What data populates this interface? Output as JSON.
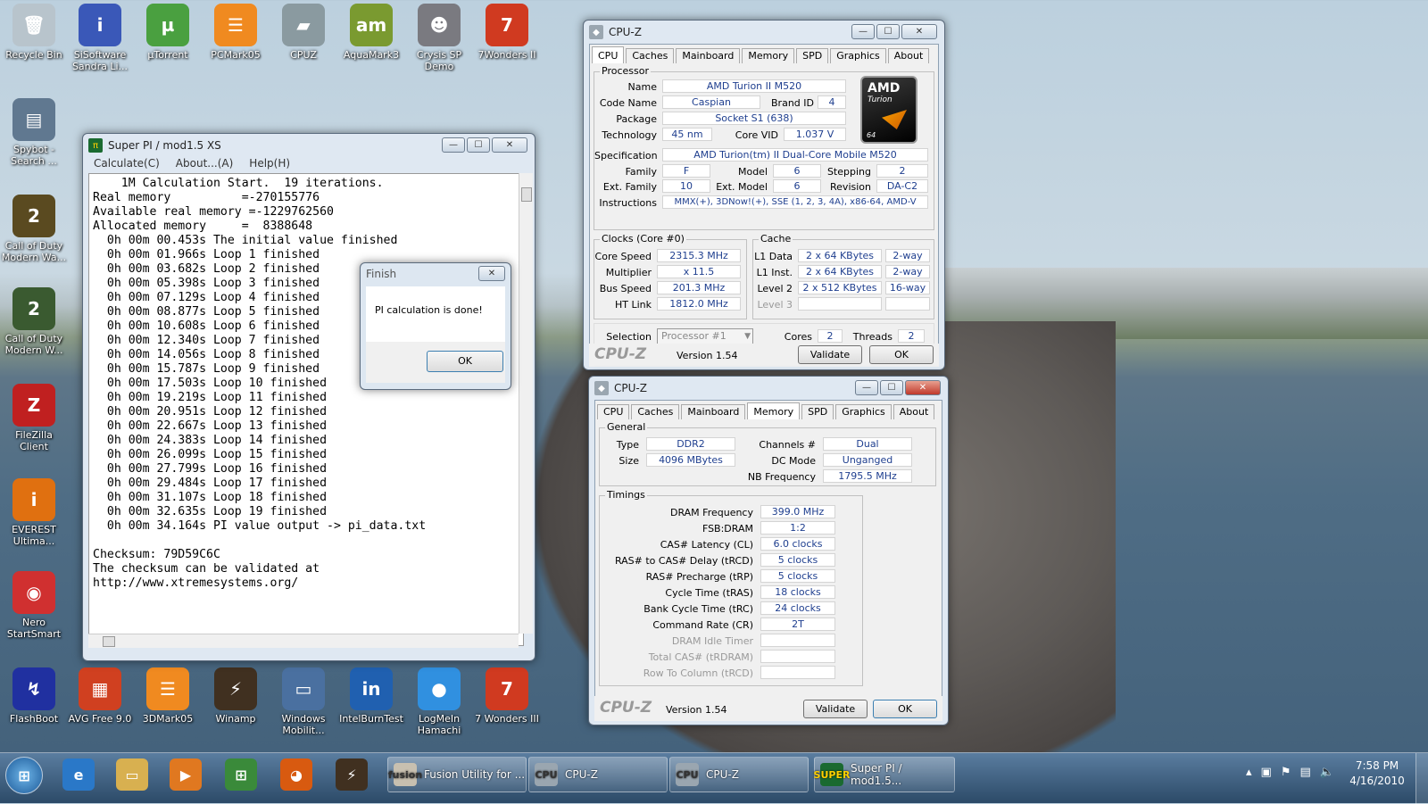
{
  "desktop": {
    "icons": [
      {
        "label": "Recycle Bin",
        "glyph": "🗑",
        "color": "#b8c4cc"
      },
      {
        "label": "SiSoftware Sandra Li...",
        "glyph": "i",
        "color": "#3a58b8"
      },
      {
        "label": "µTorrent",
        "glyph": "µ",
        "color": "#4aa040"
      },
      {
        "label": "PCMark05",
        "glyph": "☰",
        "color": "#f08a20"
      },
      {
        "label": "CPUZ",
        "glyph": "▰",
        "color": "#8a9aa0"
      },
      {
        "label": "AquaMark3",
        "glyph": "am",
        "color": "#7a9a30"
      },
      {
        "label": "Crysis SP Demo",
        "glyph": "☻",
        "color": "#7a7a80"
      },
      {
        "label": "7Wonders II",
        "glyph": "7",
        "color": "#d03a20"
      },
      {
        "label": "Spybot - Search ...",
        "glyph": "▤",
        "color": "#607890"
      },
      {
        "label": "Call of Duty Modern Wa...",
        "glyph": "2",
        "color": "#5a4a20"
      },
      {
        "label": "Call of Duty Modern W...",
        "glyph": "2",
        "color": "#3a5a30"
      },
      {
        "label": "FileZilla Client",
        "glyph": "Z",
        "color": "#c02020"
      },
      {
        "label": "EVEREST Ultima...",
        "glyph": "i",
        "color": "#e07010"
      },
      {
        "label": "Nero StartSmart",
        "glyph": "◉",
        "color": "#d03030"
      },
      {
        "label": "FlashBoot",
        "glyph": "↯",
        "color": "#2030a0"
      },
      {
        "label": "AVG Free 9.0",
        "glyph": "▦",
        "color": "#d04020"
      },
      {
        "label": "3DMark05",
        "glyph": "☰",
        "color": "#f08a20"
      },
      {
        "label": "Winamp",
        "glyph": "⚡",
        "color": "#403020"
      },
      {
        "label": "Windows Mobilit...",
        "glyph": "▭",
        "color": "#4a70a0"
      },
      {
        "label": "IntelBurnTest",
        "glyph": "in",
        "color": "#2060b0"
      },
      {
        "label": "LogMeIn Hamachi",
        "glyph": "●",
        "color": "#3090e0"
      },
      {
        "label": "7 Wonders III",
        "glyph": "7",
        "color": "#d03a20"
      }
    ]
  },
  "superpi": {
    "title": "Super PI / mod1.5 XS",
    "menu": [
      "Calculate(C)",
      "About...(A)",
      "Help(H)"
    ],
    "lines": [
      "    1M Calculation Start.  19 iterations.",
      "Real memory          =-270155776",
      "Available real memory =-1229762560",
      "Allocated memory     =  8388648",
      "  0h 00m 00.453s The initial value finished",
      "  0h 00m 01.966s Loop 1 finished",
      "  0h 00m 03.682s Loop 2 finished",
      "  0h 00m 05.398s Loop 3 finished",
      "  0h 00m 07.129s Loop 4 finished",
      "  0h 00m 08.877s Loop 5 finished",
      "  0h 00m 10.608s Loop 6 finished",
      "  0h 00m 12.340s Loop 7 finished",
      "  0h 00m 14.056s Loop 8 finished",
      "  0h 00m 15.787s Loop 9 finished",
      "  0h 00m 17.503s Loop 10 finished",
      "  0h 00m 19.219s Loop 11 finished",
      "  0h 00m 20.951s Loop 12 finished",
      "  0h 00m 22.667s Loop 13 finished",
      "  0h 00m 24.383s Loop 14 finished",
      "  0h 00m 26.099s Loop 15 finished",
      "  0h 00m 27.799s Loop 16 finished",
      "  0h 00m 29.484s Loop 17 finished",
      "  0h 00m 31.107s Loop 18 finished",
      "  0h 00m 32.635s Loop 19 finished",
      "  0h 00m 34.164s PI value output -> pi_data.txt",
      "",
      "Checksum: 79D59C6C",
      "The checksum can be validated at",
      "http://www.xtremesystems.org/"
    ]
  },
  "finish": {
    "title": "Finish",
    "message": "PI calculation is done!",
    "ok": "OK"
  },
  "cpuz1": {
    "title": "CPU-Z",
    "tabs": [
      "CPU",
      "Caches",
      "Mainboard",
      "Memory",
      "SPD",
      "Graphics",
      "About"
    ],
    "selected": "CPU",
    "processor_label": "Processor",
    "fields": {
      "name": {
        "label": "Name",
        "value": "AMD Turion II M520"
      },
      "codename": {
        "label": "Code Name",
        "value": "Caspian"
      },
      "brandid": {
        "label": "Brand ID",
        "value": "4"
      },
      "package": {
        "label": "Package",
        "value": "Socket S1 (638)"
      },
      "technology": {
        "label": "Technology",
        "value": "45 nm"
      },
      "corevid": {
        "label": "Core VID",
        "value": "1.037 V"
      },
      "spec": {
        "label": "Specification",
        "value": "AMD Turion(tm) II Dual-Core Mobile M520"
      },
      "family": {
        "label": "Family",
        "value": "F"
      },
      "model": {
        "label": "Model",
        "value": "6"
      },
      "stepping": {
        "label": "Stepping",
        "value": "2"
      },
      "extfamily": {
        "label": "Ext. Family",
        "value": "10"
      },
      "extmodel": {
        "label": "Ext. Model",
        "value": "6"
      },
      "revision": {
        "label": "Revision",
        "value": "DA-C2"
      },
      "instructions": {
        "label": "Instructions",
        "value": "MMX(+), 3DNow!(+), SSE (1, 2, 3, 4A), x86-64, AMD-V"
      }
    },
    "logo": {
      "brand": "AMD",
      "line": "Turion",
      "bits": "64"
    },
    "clocks": {
      "title": "Clocks (Core #0)",
      "corespeed": {
        "label": "Core Speed",
        "value": "2315.3 MHz"
      },
      "multiplier": {
        "label": "Multiplier",
        "value": "x 11.5"
      },
      "busspeed": {
        "label": "Bus Speed",
        "value": "201.3 MHz"
      },
      "htlink": {
        "label": "HT Link",
        "value": "1812.0 MHz"
      }
    },
    "cache": {
      "title": "Cache",
      "l1d": {
        "label": "L1 Data",
        "size": "2 x 64 KBytes",
        "way": "2-way"
      },
      "l1i": {
        "label": "L1 Inst.",
        "size": "2 x 64 KBytes",
        "way": "2-way"
      },
      "l2": {
        "label": "Level 2",
        "size": "2 x 512 KBytes",
        "way": "16-way"
      },
      "l3": {
        "label": "Level 3"
      }
    },
    "selection": {
      "label": "Selection",
      "value": "Processor #1",
      "cores_label": "Cores",
      "cores": "2",
      "threads_label": "Threads",
      "threads": "2"
    },
    "brand": "CPU-Z",
    "version": "Version 1.54",
    "validate": "Validate",
    "ok": "OK"
  },
  "cpuz2": {
    "title": "CPU-Z",
    "tabs": [
      "CPU",
      "Caches",
      "Mainboard",
      "Memory",
      "SPD",
      "Graphics",
      "About"
    ],
    "selected": "Memory",
    "general": {
      "title": "General",
      "type": {
        "label": "Type",
        "value": "DDR2"
      },
      "size": {
        "label": "Size",
        "value": "4096 MBytes"
      },
      "channels": {
        "label": "Channels #",
        "value": "Dual"
      },
      "dcmode": {
        "label": "DC Mode",
        "value": "Unganged"
      },
      "nbfreq": {
        "label": "NB Frequency",
        "value": "1795.5 MHz"
      }
    },
    "timings": {
      "title": "Timings",
      "rows": [
        {
          "label": "DRAM Frequency",
          "value": "399.0 MHz"
        },
        {
          "label": "FSB:DRAM",
          "value": "1:2"
        },
        {
          "label": "CAS# Latency (CL)",
          "value": "6.0 clocks"
        },
        {
          "label": "RAS# to CAS# Delay (tRCD)",
          "value": "5 clocks"
        },
        {
          "label": "RAS# Precharge (tRP)",
          "value": "5 clocks"
        },
        {
          "label": "Cycle Time (tRAS)",
          "value": "18 clocks"
        },
        {
          "label": "Bank Cycle Time (tRC)",
          "value": "24 clocks"
        },
        {
          "label": "Command Rate (CR)",
          "value": "2T"
        },
        {
          "label": "DRAM Idle Timer",
          "value": ""
        },
        {
          "label": "Total CAS# (tRDRAM)",
          "value": ""
        },
        {
          "label": "Row To Column (tRCD)",
          "value": ""
        }
      ]
    },
    "brand": "CPU-Z",
    "version": "Version 1.54",
    "validate": "Validate",
    "ok": "OK"
  },
  "taskbar": {
    "buttons": [
      "Fusion Utility for ...",
      "CPU-Z",
      "CPU-Z",
      "Super PI / mod1.5..."
    ],
    "button_icons": [
      "fusion",
      "CPU",
      "CPU",
      "SUPER"
    ],
    "time": "7:58 PM",
    "date": "4/16/2010"
  }
}
